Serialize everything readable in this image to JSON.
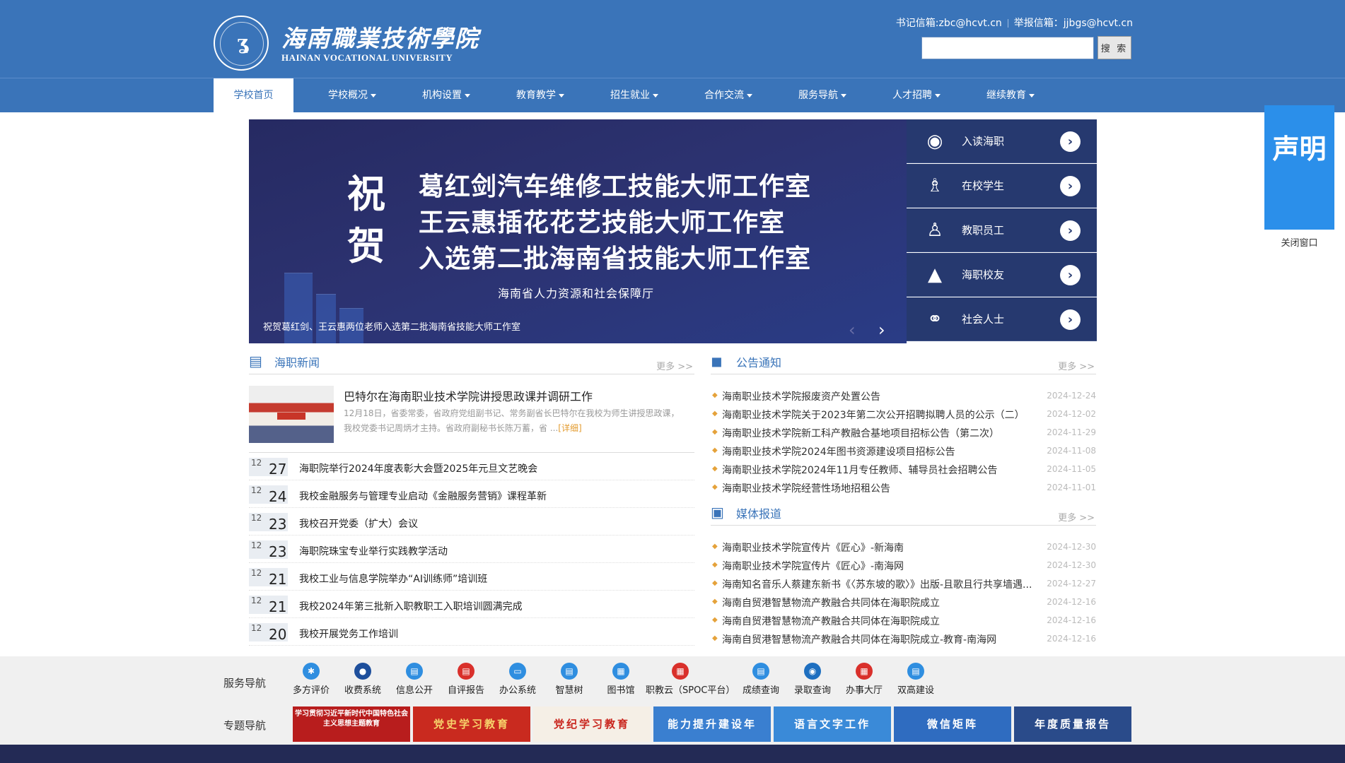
{
  "header": {
    "logo_cn": "海南職業技術學院",
    "logo_en": "HAINAN VOCATIONAL UNIVERSITY",
    "mail_secretary": "书记信箱:zbc@hcvt.cn",
    "mail_report": "举报信箱：jjbgs@hcvt.cn",
    "search_value": "",
    "search_button": "搜 索"
  },
  "nav": [
    {
      "label": "学校首页",
      "dropdown": false
    },
    {
      "label": "学校概况",
      "dropdown": true
    },
    {
      "label": "机构设置",
      "dropdown": true
    },
    {
      "label": "教育教学",
      "dropdown": true
    },
    {
      "label": "招生就业",
      "dropdown": true
    },
    {
      "label": "合作交流",
      "dropdown": true
    },
    {
      "label": "服务导航",
      "dropdown": true
    },
    {
      "label": "人才招聘",
      "dropdown": true
    },
    {
      "label": "继续教育",
      "dropdown": true
    }
  ],
  "banner": {
    "zhu": "祝",
    "he": "贺",
    "line1": "葛红剑汽车维修工技能大师工作室",
    "line2": "王云惠插花花艺技能大师工作室",
    "line3": "入选第二批海南省技能大师工作室",
    "org": "海南省人力资源和社会保障厅",
    "caption": "祝贺葛红剑、王云惠两位老师入选第二批海南省技能大师工作室"
  },
  "quick_links": [
    {
      "label": "入读海职",
      "icon": "eye-icon"
    },
    {
      "label": "在校学生",
      "icon": "student-icon"
    },
    {
      "label": "教职员工",
      "icon": "staff-icon"
    },
    {
      "label": "海职校友",
      "icon": "graduation-cap-icon"
    },
    {
      "label": "社会人士",
      "icon": "planet-icon"
    }
  ],
  "statement": {
    "text": "声明",
    "close": "关闭窗口"
  },
  "news": {
    "title": "海职新闻",
    "more": "更多 >>",
    "featured": {
      "title": "巴特尔在海南职业技术学院讲授思政课并调研工作",
      "summary": "12月18日，省委常委，省政府党组副书记、常务副省长巴特尔在我校为师生讲授思政课，我校党委书记周炳才主持。省政府副秘书长陈万蓄，省 ...",
      "detail": "[详细]"
    },
    "items": [
      {
        "month": "12",
        "day": "27",
        "title": "海职院举行2024年度表彰大会暨2025年元旦文艺晚会"
      },
      {
        "month": "12",
        "day": "24",
        "title": "我校金融服务与管理专业启动《金融服务营销》课程革新"
      },
      {
        "month": "12",
        "day": "23",
        "title": "我校召开党委（扩大）会议"
      },
      {
        "month": "12",
        "day": "23",
        "title": "海职院珠宝专业举行实践教学活动"
      },
      {
        "month": "12",
        "day": "21",
        "title": "我校工业与信息学院举办“AI训练师”培训班"
      },
      {
        "month": "12",
        "day": "21",
        "title": "我校2024年第三批新入职教职工入职培训圆满完成"
      },
      {
        "month": "12",
        "day": "20",
        "title": "我校开展党务工作培训"
      }
    ]
  },
  "notices": {
    "title": "公告通知",
    "more": "更多 >>",
    "items": [
      {
        "title": "海南职业技术学院报废资产处置公告",
        "date": "2024-12-24"
      },
      {
        "title": "海南职业技术学院关于2023年第二次公开招聘拟聘人员的公示（二）",
        "date": "2024-12-02"
      },
      {
        "title": "海南职业技术学院新工科产教融合基地项目招标公告（第二次）",
        "date": "2024-11-29"
      },
      {
        "title": "海南职业技术学院2024年图书资源建设项目招标公告",
        "date": "2024-11-08"
      },
      {
        "title": "海南职业技术学院2024年11月专任教师、辅导员社会招聘公告",
        "date": "2024-11-05"
      },
      {
        "title": "海南职业技术学院经营性场地招租公告",
        "date": "2024-11-01"
      }
    ]
  },
  "media": {
    "title": "媒体报道",
    "more": "更多 >>",
    "items": [
      {
        "title": "海南职业技术学院宣传片《匠心》-新海南",
        "date": "2024-12-30"
      },
      {
        "title": "海南职业技术学院宣传片《匠心》-南海网",
        "date": "2024-12-30"
      },
      {
        "title": "海南知名音乐人蔡建东新书《〈苏东坡的歌〉》出版-且歌且行共享墙遇...",
        "date": "2024-12-27"
      },
      {
        "title": "海南自贸港智慧物流产教融合共同体在海职院成立",
        "date": "2024-12-16"
      },
      {
        "title": "海南自贸港智慧物流产教融合共同体在海职院成立",
        "date": "2024-12-16"
      },
      {
        "title": "海南自贸港智慧物流产教融合共同体在海职院成立-教育-南海网",
        "date": "2024-12-16"
      }
    ]
  },
  "footer": {
    "service_label": "服务导航",
    "topic_label": "专题导航",
    "services": [
      {
        "label": "多方评价",
        "color": "#2f8ee0"
      },
      {
        "label": "收费系统",
        "color": "#1e4f9c"
      },
      {
        "label": "信息公开",
        "color": "#2f8ee0"
      },
      {
        "label": "自评报告",
        "color": "#d9302b"
      },
      {
        "label": "办公系统",
        "color": "#2f8ee0"
      },
      {
        "label": "智慧树",
        "color": "#2f8ee0"
      },
      {
        "label": "图书馆",
        "color": "#2f8ee0"
      },
      {
        "label": "职教云（SPOC平台）",
        "color": "#d9302b"
      },
      {
        "label": "成绩查询",
        "color": "#2f8ee0"
      },
      {
        "label": "录取查询",
        "color": "#1e6fc0"
      },
      {
        "label": "办事大厅",
        "color": "#d9302b"
      },
      {
        "label": "双高建设",
        "color": "#2f8ee0"
      }
    ],
    "topics": [
      {
        "label": "学习贯彻习近平新时代中国特色社会主义思想主题教育",
        "bg": "#b81d1d"
      },
      {
        "label": "党史学习教育",
        "bg": "#c92a1f"
      },
      {
        "label": "党纪学习教育",
        "bg": "#f5efe6"
      },
      {
        "label": "能力提升建设年",
        "bg": "#3a7fd0"
      },
      {
        "label": "语言文字工作",
        "bg": "#3a8ad8"
      },
      {
        "label": "微信矩阵",
        "bg": "#2f6cc0"
      },
      {
        "label": "年度质量报告",
        "bg": "#2a4b8a"
      }
    ]
  }
}
